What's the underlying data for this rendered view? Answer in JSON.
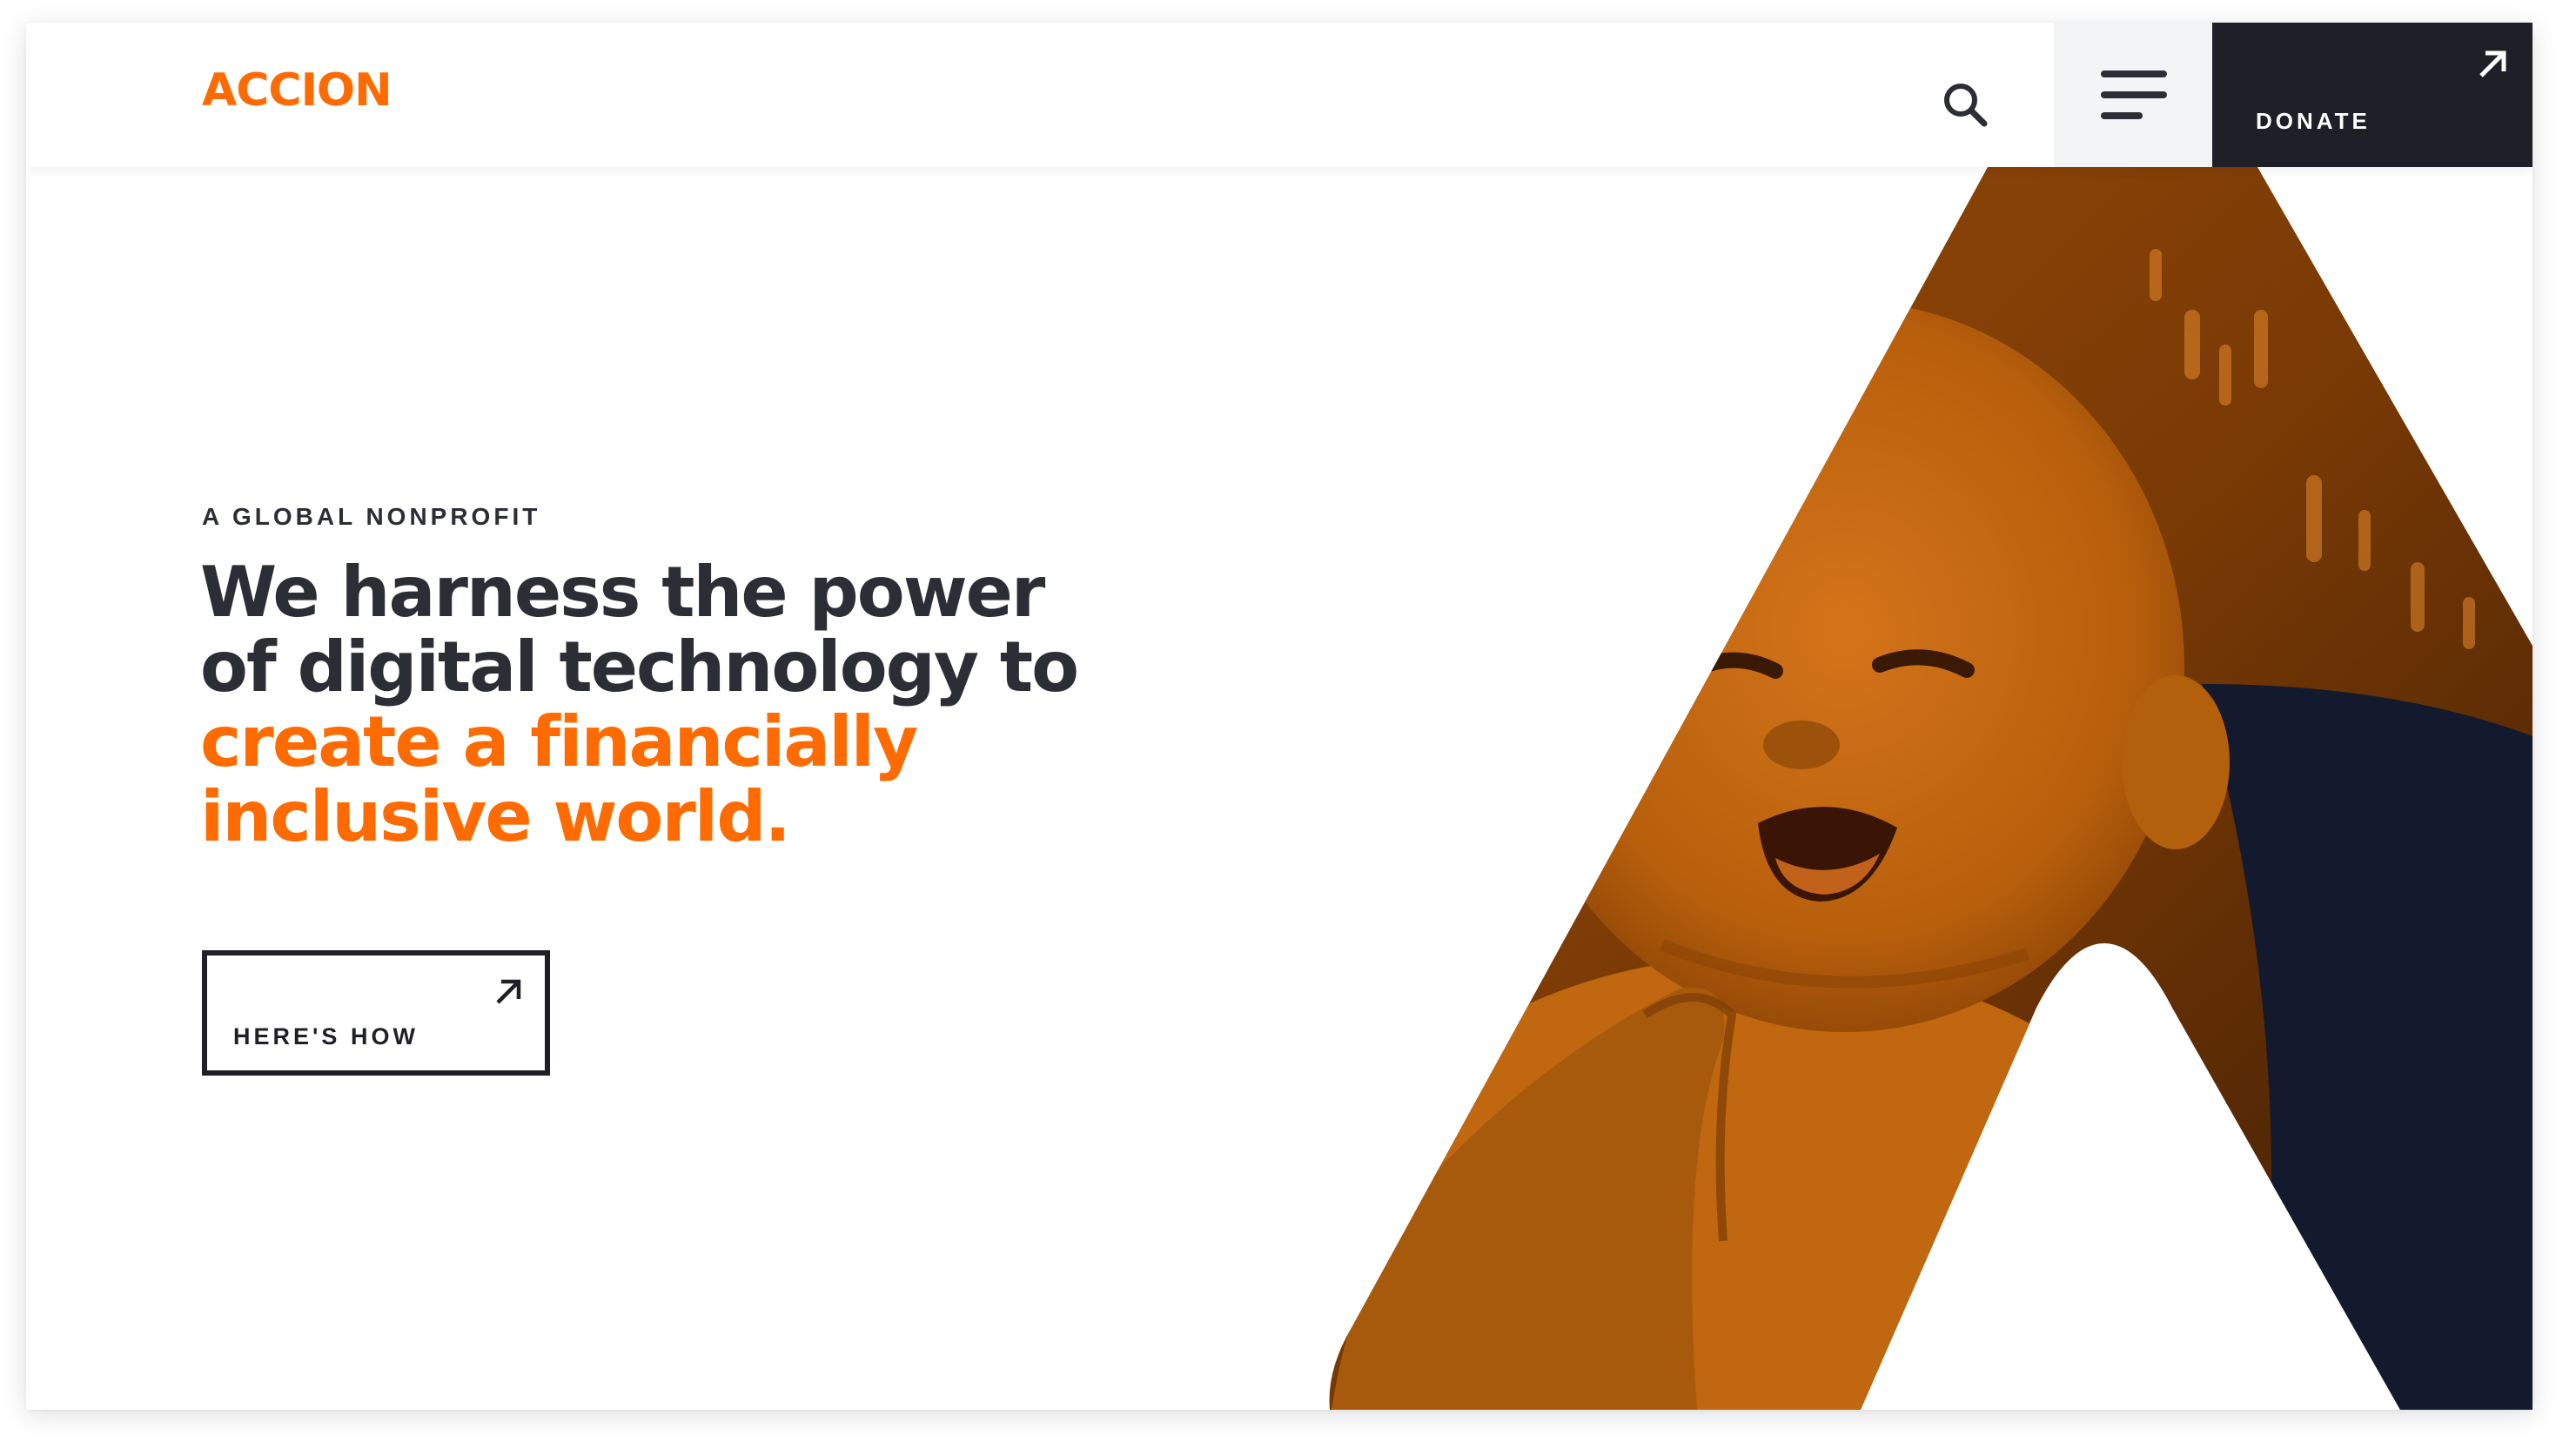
{
  "brand": {
    "logo_text": "ACCION",
    "accent_color": "#ff6b00",
    "dark_color": "#1f2027",
    "text_color": "#2c2e36"
  },
  "header": {
    "search_icon": "search-icon",
    "menu_icon": "hamburger-menu-icon",
    "donate_label": "DONATE",
    "donate_icon": "arrow-up-right-icon"
  },
  "hero": {
    "eyebrow": "A GLOBAL NONPROFIT",
    "headline_line1": "We harness the power",
    "headline_line2": "of digital technology to",
    "headline_accent_line1": "create a financially",
    "headline_accent_line2": "inclusive world.",
    "cta_label": "HERE'S HOW",
    "cta_icon": "arrow-up-right-icon",
    "image_subject": "smiling-baby-photo"
  }
}
